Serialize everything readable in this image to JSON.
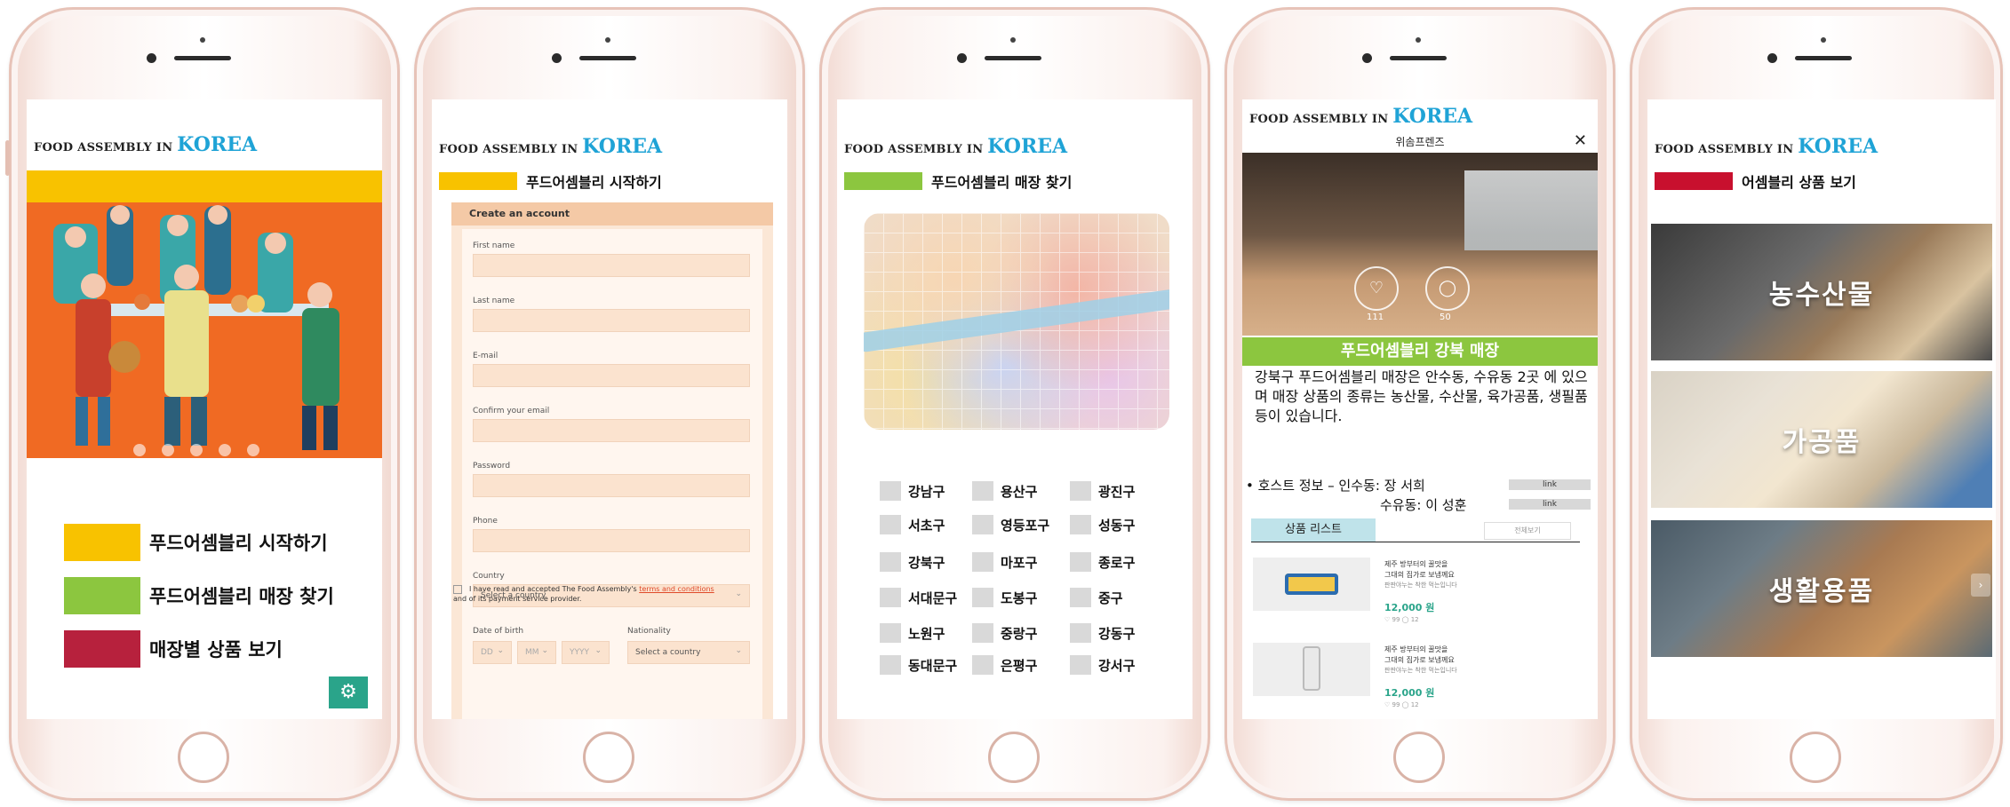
{
  "brand": {
    "prefix": "FOOD ASSEMBLY IN",
    "highlight": "KOREA"
  },
  "colors": {
    "yellow": "#f8c200",
    "green": "#8cc63f",
    "red": "#b7213d",
    "darkred": "#c8102e",
    "teal": "#2aa48a",
    "korea_blue": "#1fa3d6"
  },
  "screen1": {
    "carousel_pages": 5,
    "menu": [
      {
        "label": "푸드어셈블리 시작하기",
        "color": "#f8c200"
      },
      {
        "label": "푸드어셈블리 매장 찾기",
        "color": "#8cc63f"
      },
      {
        "label": "매장별 상품 보기",
        "color": "#b7213d"
      }
    ],
    "settings_icon": "gear-icon"
  },
  "screen2": {
    "section_title": "푸드어셈블리 시작하기",
    "form_title": "Create an account",
    "fields": [
      "First name",
      "Last name",
      "E-mail",
      "Confirm your email",
      "Password",
      "Phone"
    ],
    "country_label": "Country",
    "country_placeholder": "Select a country",
    "dob_label": "Date of birth",
    "dob_dd": "DD",
    "dob_mm": "MM",
    "dob_yyyy": "YYYY",
    "nationality_label": "Nationality",
    "nationality_placeholder": "Select a country",
    "terms_pre": "I have read and accepted The Food Assembly's",
    "terms_link": "terms and conditions",
    "terms_post": "and of its payment service provider."
  },
  "screen3": {
    "section_title": "푸드어셈블리 매장 찾기",
    "districts": [
      [
        "강남구",
        "용산구",
        "광진구"
      ],
      [
        "서초구",
        "영등포구",
        "성동구"
      ],
      [
        "강북구",
        "마포구",
        "종로구"
      ],
      [
        "서대문구",
        "도봉구",
        "중구"
      ],
      [
        "노원구",
        "중랑구",
        "강동구"
      ],
      [
        "동대문구",
        "은평구",
        "강서구"
      ]
    ]
  },
  "screen4": {
    "store_name": "위솜프렌즈",
    "likes": "111",
    "comments": "50",
    "banner": "푸드어셈블리 강북 매장",
    "description": "강북구 푸드어셈블리 매장은 안수동, 수유동 2곳 에 있으며 매장 상품의 종류는 농산물, 수산물, 육가공품, 생필품 등이 있습니다.",
    "host_1": "• 호스트 정보 – 인수동: 장 서희",
    "host_2": "수유동: 이 성훈",
    "link_label": "link",
    "tab_label": "상품 리스트",
    "more_label": "전체보기",
    "products": [
      {
        "title1": "제주 방부터의 꿀맛을",
        "title2": "그대의 집가로 보냅께요",
        "sub": "판판야누는 착한 먹는입니다",
        "price": "12,000 원",
        "meta": "♡ 99   ◯ 12"
      },
      {
        "title1": "제주 방부터의 꿀맛을",
        "title2": "그대의 집가로 보냅께요",
        "sub": "판판야누는 착한 먹는입니다",
        "price": "12,000 원",
        "meta": "♡ 99   ◯ 12"
      }
    ]
  },
  "screen5": {
    "section_title": "어셈블리 상품 보기",
    "categories": [
      "농수산물",
      "가공품",
      "생활용품"
    ]
  }
}
